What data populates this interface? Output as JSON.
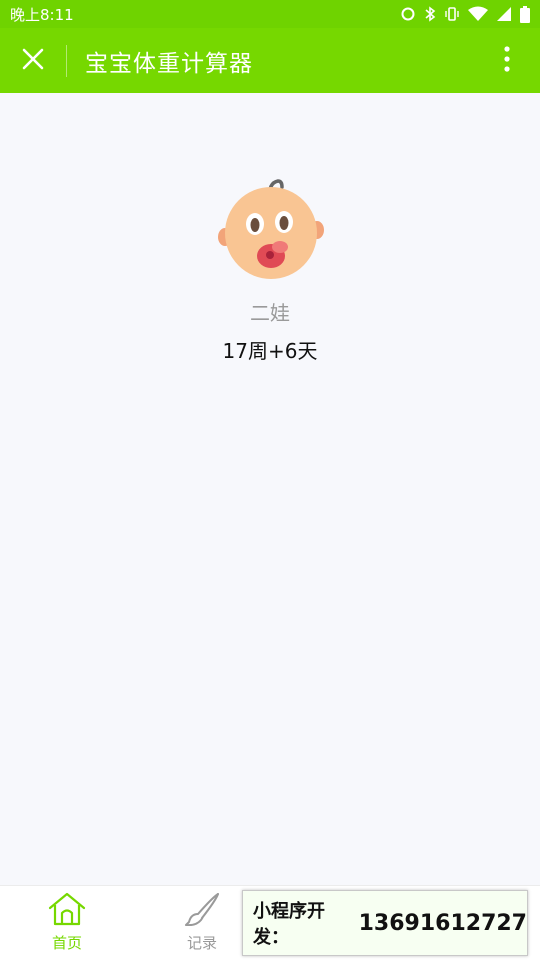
{
  "status_bar": {
    "time": "晚上8:11",
    "icons": [
      "sync-icon",
      "bluetooth-icon",
      "vibrate-icon",
      "wifi-icon",
      "signal-icon",
      "battery-icon"
    ]
  },
  "nav": {
    "title": "宝宝体重计算器",
    "close_icon": "close-icon",
    "more_icon": "more-vertical-icon"
  },
  "baby": {
    "name": "二娃",
    "age": "17周+6天",
    "avatar_icon": "baby-face-icon"
  },
  "tab_bar": {
    "tabs": [
      {
        "label": "首页",
        "icon": "home-icon",
        "active": true
      },
      {
        "label": "记录",
        "icon": "brush-icon",
        "active": false
      }
    ]
  },
  "promo": {
    "label": "小程序开发：",
    "phone": "13691612727"
  },
  "colors": {
    "accent": "#76d800",
    "status_bar": "#6fd300",
    "background": "#f7f8fc",
    "inactive": "#9a9a9a"
  }
}
